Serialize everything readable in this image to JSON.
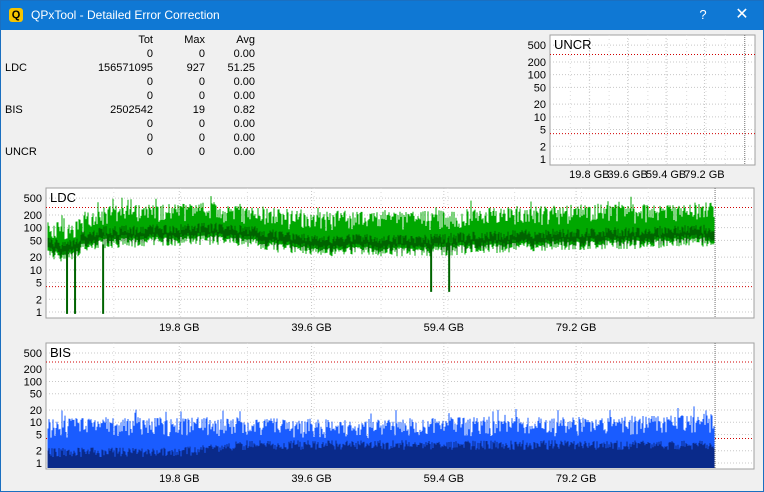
{
  "window": {
    "title": "QPxTool - Detailed Error Correction",
    "help_label": "?",
    "close_label": "✕",
    "app_icon_label": "Q"
  },
  "stats": {
    "headers": [
      "Tot",
      "Max",
      "Avg"
    ],
    "rows": [
      {
        "label": "",
        "tot": "0",
        "max": "0",
        "avg": "0.00"
      },
      {
        "label": "LDC",
        "tot": "156571095",
        "max": "927",
        "avg": "51.25"
      },
      {
        "label": "",
        "tot": "0",
        "max": "0",
        "avg": "0.00"
      },
      {
        "label": "",
        "tot": "0",
        "max": "0",
        "avg": "0.00"
      },
      {
        "label": "BIS",
        "tot": "2502542",
        "max": "19",
        "avg": "0.82"
      },
      {
        "label": "",
        "tot": "0",
        "max": "0",
        "avg": "0.00"
      },
      {
        "label": "",
        "tot": "0",
        "max": "0",
        "avg": "0.00"
      },
      {
        "label": "UNCR",
        "tot": "0",
        "max": "0",
        "avg": "0.00"
      }
    ]
  },
  "chart_data": [
    {
      "id": "uncr",
      "type": "area",
      "title": "UNCR",
      "y_scale": "log",
      "y_ticks": [
        "500",
        "200",
        "100",
        "50",
        "20",
        "10",
        "5",
        "2",
        "1"
      ],
      "x_ticks": [
        "19.8 GB",
        "39.6 GB",
        "59.4 GB",
        "79.2 GB"
      ],
      "series": [],
      "grid": true
    },
    {
      "id": "ldc",
      "type": "area",
      "title": "LDC",
      "y_scale": "log",
      "y_ticks": [
        "500",
        "200",
        "100",
        "50",
        "20",
        "10",
        "5",
        "2",
        "1"
      ],
      "x_ticks": [
        "19.8 GB",
        "39.6 GB",
        "59.4 GB",
        "79.2 GB"
      ],
      "x_range_gb": [
        0,
        100
      ],
      "grid": true,
      "colors": {
        "max": "#00a800",
        "avg": "#006400"
      },
      "profile": {
        "x_gb": [
          0,
          2,
          4,
          5,
          6,
          8,
          12,
          16,
          20,
          25,
          30,
          35,
          40,
          45,
          50,
          55,
          60,
          65,
          70,
          75,
          80,
          85,
          90,
          95,
          100
        ],
        "max": [
          120,
          100,
          100,
          160,
          200,
          240,
          250,
          270,
          290,
          300,
          270,
          210,
          180,
          200,
          190,
          185,
          200,
          220,
          240,
          250,
          260,
          270,
          280,
          290,
          300
        ],
        "avg": [
          50,
          45,
          45,
          70,
          80,
          90,
          95,
          100,
          105,
          110,
          95,
          70,
          55,
          60,
          58,
          56,
          62,
          68,
          74,
          78,
          82,
          86,
          90,
          95,
          100
        ]
      }
    },
    {
      "id": "bis",
      "type": "area",
      "title": "BIS",
      "y_scale": "log",
      "y_ticks": [
        "500",
        "200",
        "100",
        "50",
        "20",
        "10",
        "5",
        "2",
        "1"
      ],
      "x_ticks": [
        "19.8 GB",
        "39.6 GB",
        "59.4 GB",
        "79.2 GB"
      ],
      "x_range_gb": [
        0,
        100
      ],
      "grid": true,
      "colors": {
        "max": "#1a5cff",
        "avg": "#0a2a8a"
      },
      "profile": {
        "x_gb": [
          0,
          10,
          20,
          30,
          40,
          50,
          60,
          70,
          80,
          90,
          100
        ],
        "max": [
          9,
          10,
          10,
          10,
          9,
          9,
          10,
          10,
          10,
          11,
          12
        ],
        "avg": [
          2,
          2,
          2,
          3,
          3,
          3,
          3,
          3,
          3,
          3,
          3
        ]
      }
    }
  ]
}
